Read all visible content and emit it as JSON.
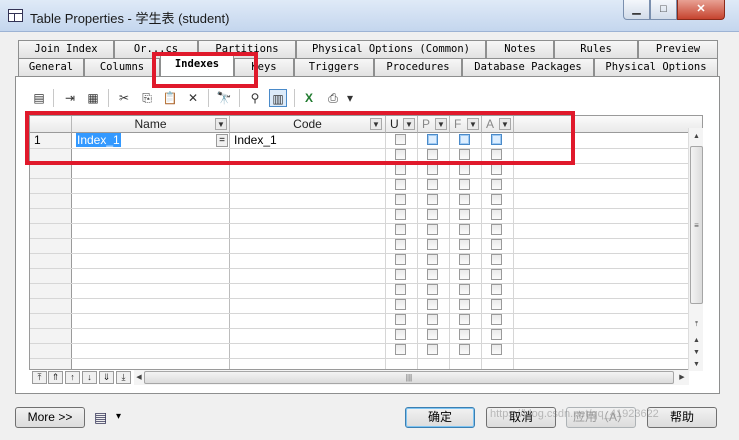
{
  "window": {
    "title": "Table Properties - 学生表 (student)",
    "minimize": "▁",
    "maximize": "□",
    "close": "✕"
  },
  "tabs": {
    "row_back": [
      "Join Index",
      "Or...cs",
      "Partitions",
      "Physical Options (Common)",
      "Notes",
      "Rules",
      "Preview"
    ],
    "row_front": [
      "General",
      "Columns",
      "Indexes",
      "Keys",
      "Triggers",
      "Procedures",
      "Database Packages",
      "Physical Options"
    ],
    "active": "Indexes"
  },
  "toolbar": {
    "icons": [
      "properties-icon",
      "insert-row-icon",
      "add-row-icon",
      "cut-icon",
      "copy-icon",
      "paste-icon",
      "delete-icon",
      "find-icon",
      "filter-icon",
      "customize-columns-icon",
      "excel-export-icon",
      "print-icon",
      "dropdown-arrow-icon"
    ],
    "glyphs": [
      "▤",
      "⇥",
      "▦",
      "✂",
      "⎘",
      "📋",
      "✕",
      "🔭",
      "⚲",
      "▥",
      "X",
      "⎙",
      "▾"
    ]
  },
  "grid": {
    "columns": {
      "name": "Name",
      "code": "Code",
      "u": "U",
      "p": "P",
      "f": "F",
      "a": "A"
    },
    "rows": [
      {
        "number": "1",
        "name": "Index_1",
        "link": "=",
        "code": "Index_1"
      }
    ],
    "empty_rows": 14
  },
  "nav_buttons": [
    "⤒",
    "⇑",
    "↑",
    "↓",
    "⇓",
    "⤓"
  ],
  "footer": {
    "more": "More >>",
    "menu_glyph": "▤",
    "menu_arrow": "▾",
    "ok": "确定",
    "cancel": "取消",
    "apply": "应用（A）",
    "help": "帮助"
  },
  "watermark": "https://blog.csdn.net/qq_41923622"
}
